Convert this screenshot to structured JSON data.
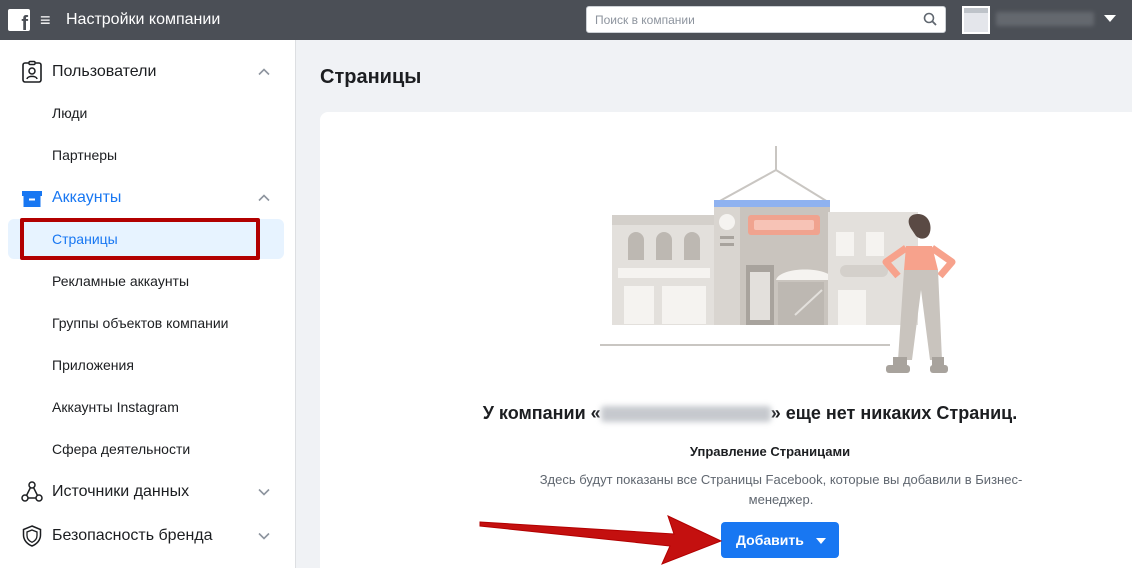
{
  "header": {
    "logo_letter": "f",
    "menu_glyph": "≡",
    "title": "Настройки компании",
    "search_placeholder": "Поиск в компании"
  },
  "sidebar": {
    "sections": [
      {
        "label": "Пользователи",
        "icon": "user-badge-icon",
        "expanded": true,
        "items": [
          "Люди",
          "Партнеры"
        ]
      },
      {
        "label": "Аккаунты",
        "icon": "briefcase-icon",
        "expanded": true,
        "active": true,
        "items": [
          "Страницы",
          "Рекламные аккаунты",
          "Группы объектов компании",
          "Приложения",
          "Аккаунты Instagram",
          "Сфера деятельности"
        ],
        "selected_item": "Страницы"
      },
      {
        "label": "Источники данных",
        "icon": "data-sources-icon",
        "expanded": false
      },
      {
        "label": "Безопасность бренда",
        "icon": "shield-icon",
        "expanded": false
      }
    ]
  },
  "main": {
    "page_title": "Страницы",
    "empty_title_prefix": "У компании «",
    "empty_title_suffix": "» еще нет никаких Страниц.",
    "subheading": "Управление Страницами",
    "description": "Здесь будут показаны все Страницы Facebook, которые вы добавили в Бизнес-менеджер.",
    "add_button_label": "Добавить"
  },
  "colors": {
    "topbar": "#4b4f56",
    "accent": "#1877f2",
    "annotation_red": "#b20000"
  }
}
